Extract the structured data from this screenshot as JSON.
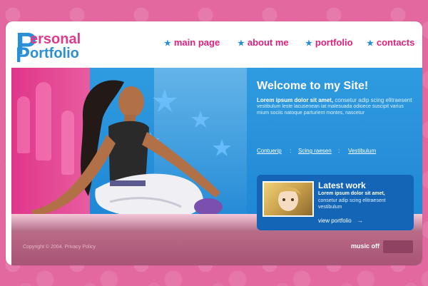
{
  "header": {
    "logo": {
      "letter_p": "P",
      "word_top": "ersonal",
      "word_bottom": "ortfolio"
    },
    "nav": [
      {
        "label": "main page",
        "icon": "star-icon"
      },
      {
        "label": "about me",
        "icon": "star-icon"
      },
      {
        "label": "portfolio",
        "icon": "star-icon"
      },
      {
        "label": "contacts",
        "icon": "star-icon"
      }
    ]
  },
  "hero": {
    "title": "Welcome to my Site!",
    "lead": "Lorem ipsum dolor sit amet,",
    "lead_rest": "consetur adip scing elitraesent",
    "body": "vestibulum leste lacusenean iat malesuada odioece suscipit varius mium sociis natoque parturient montes, nascetur",
    "links": [
      "Contuerip",
      "Scing raesen",
      "Vestibulum"
    ]
  },
  "latest": {
    "title": "Latest work",
    "lead": "Lorem ipsum dolor sit amet,",
    "body": "consetur adip scing elitraesent vestibulum",
    "link_label": "view portfolio"
  },
  "footer": {
    "copyright": "Copyright © 2004. Privacy Policy",
    "music_label": "music off"
  },
  "colors": {
    "brand_blue": "#2a8fd6",
    "brand_pink": "#e0207c",
    "page_bg": "#e2689f"
  }
}
